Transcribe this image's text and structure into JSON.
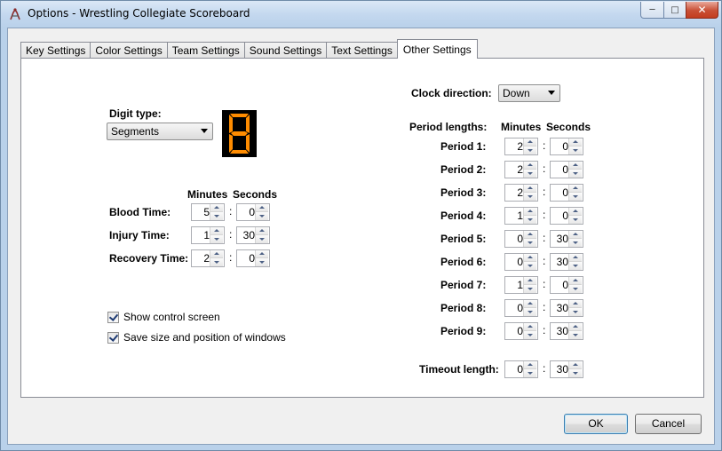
{
  "window": {
    "title": "Options - Wrestling Collegiate Scoreboard"
  },
  "tabs": [
    "Key Settings",
    "Color Settings",
    "Team Settings",
    "Sound Settings",
    "Text Settings",
    "Other Settings"
  ],
  "digit": {
    "label": "Digit type:",
    "value": "Segments",
    "color": "#ff8c00"
  },
  "times": {
    "minutes_header": "Minutes",
    "seconds_header": "Seconds",
    "rows": [
      {
        "label": "Blood Time:",
        "minutes": "5",
        "seconds": "0"
      },
      {
        "label": "Injury Time:",
        "minutes": "1",
        "seconds": "30"
      },
      {
        "label": "Recovery Time:",
        "minutes": "2",
        "seconds": "0"
      }
    ]
  },
  "checkboxes": [
    {
      "label": "Show control screen",
      "checked": true
    },
    {
      "label": "Save size and position of windows",
      "checked": true
    }
  ],
  "clock": {
    "label": "Clock direction:",
    "value": "Down"
  },
  "periods": {
    "header": "Period lengths:",
    "minutes_header": "Minutes",
    "seconds_header": "Seconds",
    "rows": [
      {
        "label": "Period 1:",
        "minutes": "2",
        "seconds": "0"
      },
      {
        "label": "Period 2:",
        "minutes": "2",
        "seconds": "0"
      },
      {
        "label": "Period 3:",
        "minutes": "2",
        "seconds": "0"
      },
      {
        "label": "Period 4:",
        "minutes": "1",
        "seconds": "0"
      },
      {
        "label": "Period 5:",
        "minutes": "0",
        "seconds": "30"
      },
      {
        "label": "Period 6:",
        "minutes": "0",
        "seconds": "30"
      },
      {
        "label": "Period 7:",
        "minutes": "1",
        "seconds": "0"
      },
      {
        "label": "Period 8:",
        "minutes": "0",
        "seconds": "30"
      },
      {
        "label": "Period 9:",
        "minutes": "0",
        "seconds": "30"
      }
    ]
  },
  "timeout": {
    "label": "Timeout length:",
    "minutes": "0",
    "seconds": "30"
  },
  "colon": ":",
  "buttons": {
    "ok": "OK",
    "cancel": "Cancel"
  }
}
